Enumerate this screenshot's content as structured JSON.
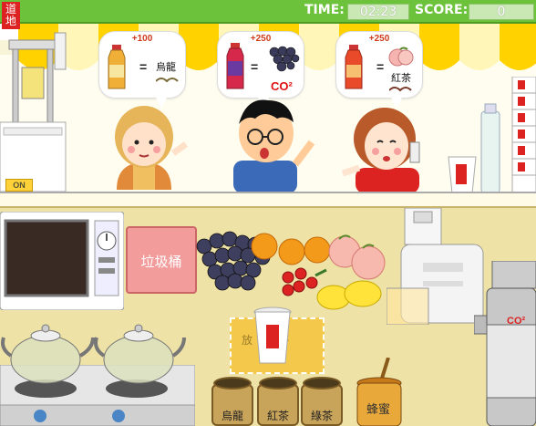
{
  "hud": {
    "time_label": "TIME:",
    "time_value": "02:23",
    "score_label": "SCORE:",
    "score_value": "0"
  },
  "logo": {
    "text": "道地",
    "sub": "DOH"
  },
  "orders": [
    {
      "points": "+100",
      "result": "烏龍",
      "ingredient": "oolong-leaves"
    },
    {
      "points": "+250",
      "result": "CO²",
      "ingredient": "grapes"
    },
    {
      "points": "+250",
      "result": "紅茶",
      "ingredient": "peach"
    }
  ],
  "kitchen": {
    "trash_label": "垃圾桶",
    "on_button": "ON",
    "cup_zone_text": "放杯",
    "co2_tank_label": "CO²",
    "honey_label": "蜂蜜",
    "jars": [
      {
        "label": "烏龍"
      },
      {
        "label": "紅茶"
      },
      {
        "label": "綠茶"
      }
    ]
  },
  "colors": {
    "hud_green": "#6cc23a",
    "awning_yellow": "#ffd200",
    "trash_pink": "#f29c9c",
    "accent_red": "#d22222"
  }
}
